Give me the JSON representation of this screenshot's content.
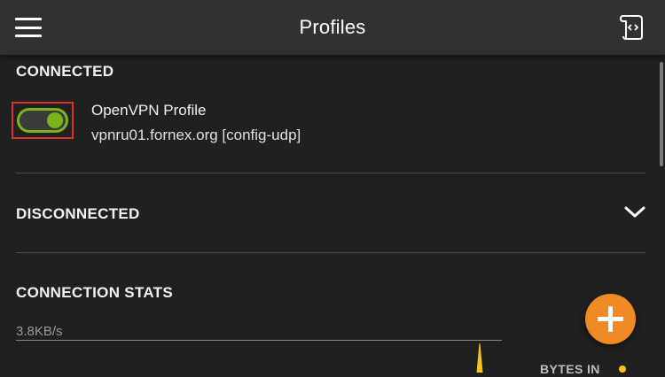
{
  "header": {
    "title": "Profiles"
  },
  "icons": {
    "menu": "hamburger-menu-icon",
    "import": "import-profile-icon",
    "expand": "chevron-down-icon",
    "add": "plus-icon"
  },
  "connected": {
    "title": "CONNECTED",
    "profile": {
      "name": "OpenVPN Profile",
      "server": "vpnru01.fornex.org [config-udp]",
      "toggle_on": true
    }
  },
  "disconnected": {
    "title": "DISCONNECTED"
  },
  "stats": {
    "title": "CONNECTION STATS",
    "rate_label": "3.8KB/s",
    "legend_bytes_in": "BYTES IN"
  },
  "colors": {
    "background": "#202020",
    "topbar": "#313131",
    "toggle_green": "#7bb31a",
    "highlight_red": "#d8362a",
    "fab_orange": "#f08a24",
    "bytes_in_yellow": "#f5c518"
  }
}
